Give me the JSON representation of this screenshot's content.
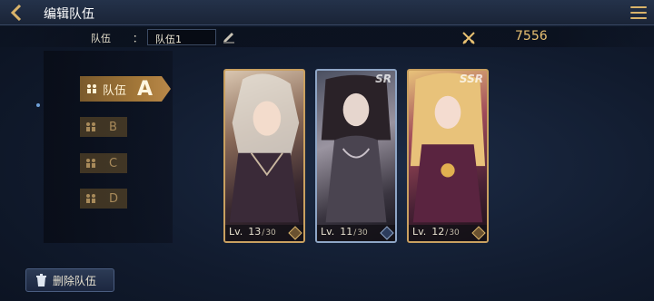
{
  "header": {
    "title": "编辑队伍"
  },
  "team_bar": {
    "label": "队伍",
    "colon": "：",
    "name_value": "队伍1",
    "power_value": "7556"
  },
  "team_tabs": {
    "active": {
      "label": "队伍",
      "letter": "A"
    },
    "others": [
      "B",
      "C",
      "D"
    ]
  },
  "cards": [
    {
      "lv_label": "Lv.",
      "level": "13",
      "slash": "/",
      "max": "30",
      "rarity": ""
    },
    {
      "lv_label": "Lv.",
      "level": "11",
      "slash": "/",
      "max": "30",
      "rarity": "SR"
    },
    {
      "lv_label": "Lv.",
      "level": "12",
      "slash": "/",
      "max": "30",
      "rarity": "SSR"
    }
  ],
  "footer": {
    "delete_label": "删除队伍"
  },
  "colors": {
    "accent_gold": "#c9a060",
    "power_text": "#e9c172",
    "background": "#111b2e"
  },
  "icons": [
    "back-arrow-icon",
    "menu-icon",
    "pencil-icon",
    "crossed-swords-icon",
    "team-icon",
    "element-icon",
    "trash-icon"
  ]
}
